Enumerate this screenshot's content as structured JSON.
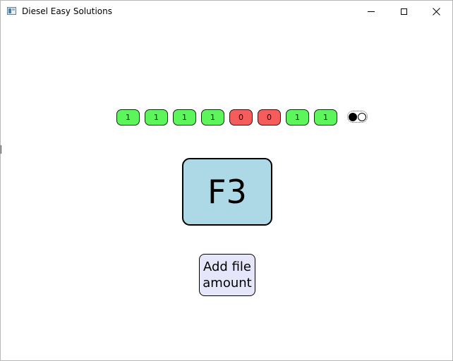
{
  "window": {
    "title": "Diesel Easy Solutions"
  },
  "controls": {
    "minimize_icon": "minimize-icon",
    "maximize_icon": "maximize-icon",
    "close_icon": "close-icon",
    "close_glyph": "✕"
  },
  "bits": [
    {
      "label": "1",
      "color": "#5cf55c"
    },
    {
      "label": "1",
      "color": "#5cf55c"
    },
    {
      "label": "1",
      "color": "#5cf55c"
    },
    {
      "label": "1",
      "color": "#5cf55c"
    },
    {
      "label": "0",
      "color": "#f55c5c"
    },
    {
      "label": "0",
      "color": "#f55c5c"
    },
    {
      "label": "1",
      "color": "#5cf55c"
    },
    {
      "label": "1",
      "color": "#5cf55c"
    }
  ],
  "radio": {
    "selected": "first"
  },
  "main_button": {
    "label": "F3",
    "color": "#add8e6"
  },
  "add_button": {
    "line1": "Add file",
    "line2": "amount",
    "color": "#e6e6fa"
  }
}
